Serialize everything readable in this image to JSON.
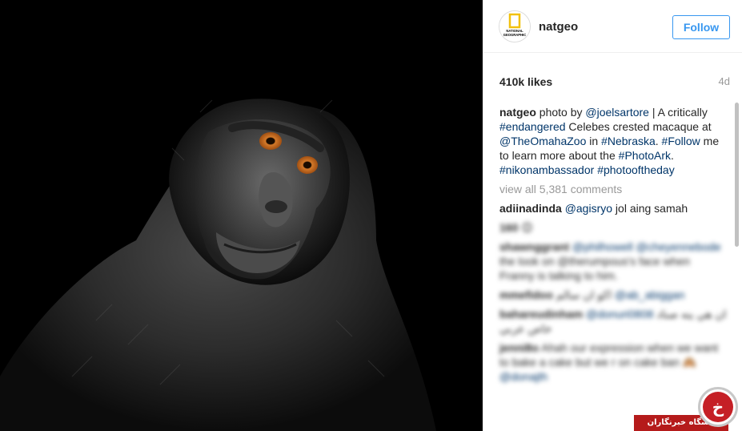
{
  "post": {
    "image_alt": "Celebes crested macaque portrait on black background"
  },
  "header": {
    "avatar_icon": "national-geographic-logo-icon",
    "avatar_text_1": "NATIONAL",
    "avatar_text_2": "GEOGRAPHIC",
    "username": "natgeo",
    "follow_label": "Follow"
  },
  "stats": {
    "likes": "410k likes",
    "age": "4d"
  },
  "caption": {
    "author": "natgeo",
    "t1": " photo by ",
    "l1": "@joelsartore",
    "t2": " | A critically ",
    "l2": "#endangered",
    "t3": " Celebes crested macaque at ",
    "l3": "@TheOmahaZoo",
    "t4": " in ",
    "l4": "#Nebraska",
    "t5": ". ",
    "l5": "#Follow",
    "t6": " me to learn more about the ",
    "l6": "#PhotoArk",
    "t7": ". ",
    "l7": "#nikonambassador",
    "t8": " ",
    "l8": "#photooftheday"
  },
  "view_all": "view all 5,381 comments",
  "comments": [
    {
      "author": "adiinadinda",
      "mention": "@agisryo",
      "text": " jol aing samah"
    },
    {
      "author": "160",
      "text": " 😊"
    },
    {
      "author": "shawnggrant",
      "mention": "@philhowell @cheyennebode",
      "text": " the look on @therumpous's face when Franny is talking to him."
    },
    {
      "author": "mmefidoo",
      "text": " اكو ان سالم",
      "mention": "@ab_abiggan"
    },
    {
      "author": "bahareudinham",
      "mention": "@donuri0808",
      "text": " ان هي ينه صناد خاص عربي"
    },
    {
      "author": "jenni8o",
      "text": " Ahah our expression when we want to bake a cake but we r on cake ban 🙈",
      "mention": "@donajth"
    }
  ],
  "badge": {
    "logo_glyph": "خ",
    "label": "باشگاه خبرنگاران"
  },
  "colors": {
    "follow_blue": "#3897f0",
    "link_blue": "#003569",
    "muted_gray": "#999999",
    "badge_red": "#b51b1b"
  }
}
